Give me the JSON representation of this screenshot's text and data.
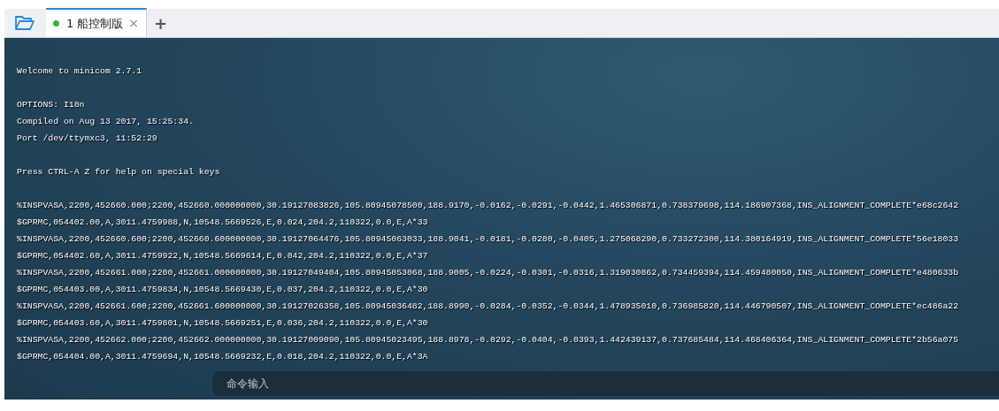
{
  "tabs": [
    {
      "number": "1",
      "title": "船控制版",
      "selected": true,
      "color": "#22bb33",
      "close": "×"
    }
  ],
  "new_tab": "+",
  "terminal": {
    "blocks": [
      [
        "Welcome to minicom 2.7.1"
      ],
      [
        "OPTIONS: I18n",
        "Compiled on Aug 13 2017, 15:25:34.",
        "Port /dev/ttymxc3, 11:52:29"
      ],
      [
        "Press CTRL-A Z for help on special keys"
      ],
      [
        "%INSPVASA,2200,452660.000;2200,452660.000000000,30.19127083826,105.80945078500,188.9170,-0.0162,-0.0291,-0.0442,1.465306871,0.738379698,114.186907368,INS_ALIGNMENT_COMPLETE*e68c2642",
        "$GPRMC,054402.00,A,3011.4759988,N,10548.5669526,E,0.024,204.2,110322,0.0,E,A*33",
        "%INSPVASA,2200,452660.600;2200,452660.600000000,30.19127064476,105.80945063033,188.9041,-0.0181,-0.0280,-0.0405,1.275068290,0.733272300,114.380164919,INS_ALIGNMENT_COMPLETE*56e18033",
        "$GPRMC,054402.60,A,3011.4759922,N,10548.5669614,E,0.042,204.2,110322,0.0,E,A*37",
        "%INSPVASA,2200,452661.000;2200,452661.000000000,30.19127049404,105.80945053068,188.9005,-0.0224,-0.0301,-0.0316,1.319030862,0.734459394,114.459480050,INS_ALIGNMENT_COMPLETE*e480633b",
        "$GPRMC,054403.00,A,3011.4759834,N,10548.5669430,E,0.037,204.2,110322,0.0,E,A*30",
        "%INSPVASA,2200,452661.600;2200,452661.600000000,30.19127026358,105.80945036482,188.8990,-0.0284,-0.0352,-0.0344,1.478935010,0.736985820,114.446790507,INS_ALIGNMENT_COMPLETE*ec486a22",
        "$GPRMC,054403.60,A,3011.4759801,N,10548.5669251,E,0.036,204.2,110322,0.0,E,A*30",
        "%INSPVASA,2200,452662.000;2200,452662.000000000,30.19127009090,105.80945023495,188.8978,-0.0292,-0.0404,-0.0393,1.442439137,0.737685484,114.468406364,INS_ALIGNMENT_COMPLETE*2b56a075",
        "$GPRMC,054404.00,A,3011.4759694,N,10548.5669232,E,0.018,204.2,110322,0.0,E,A*3A"
      ]
    ]
  },
  "command": {
    "placeholder": "命令输入"
  }
}
